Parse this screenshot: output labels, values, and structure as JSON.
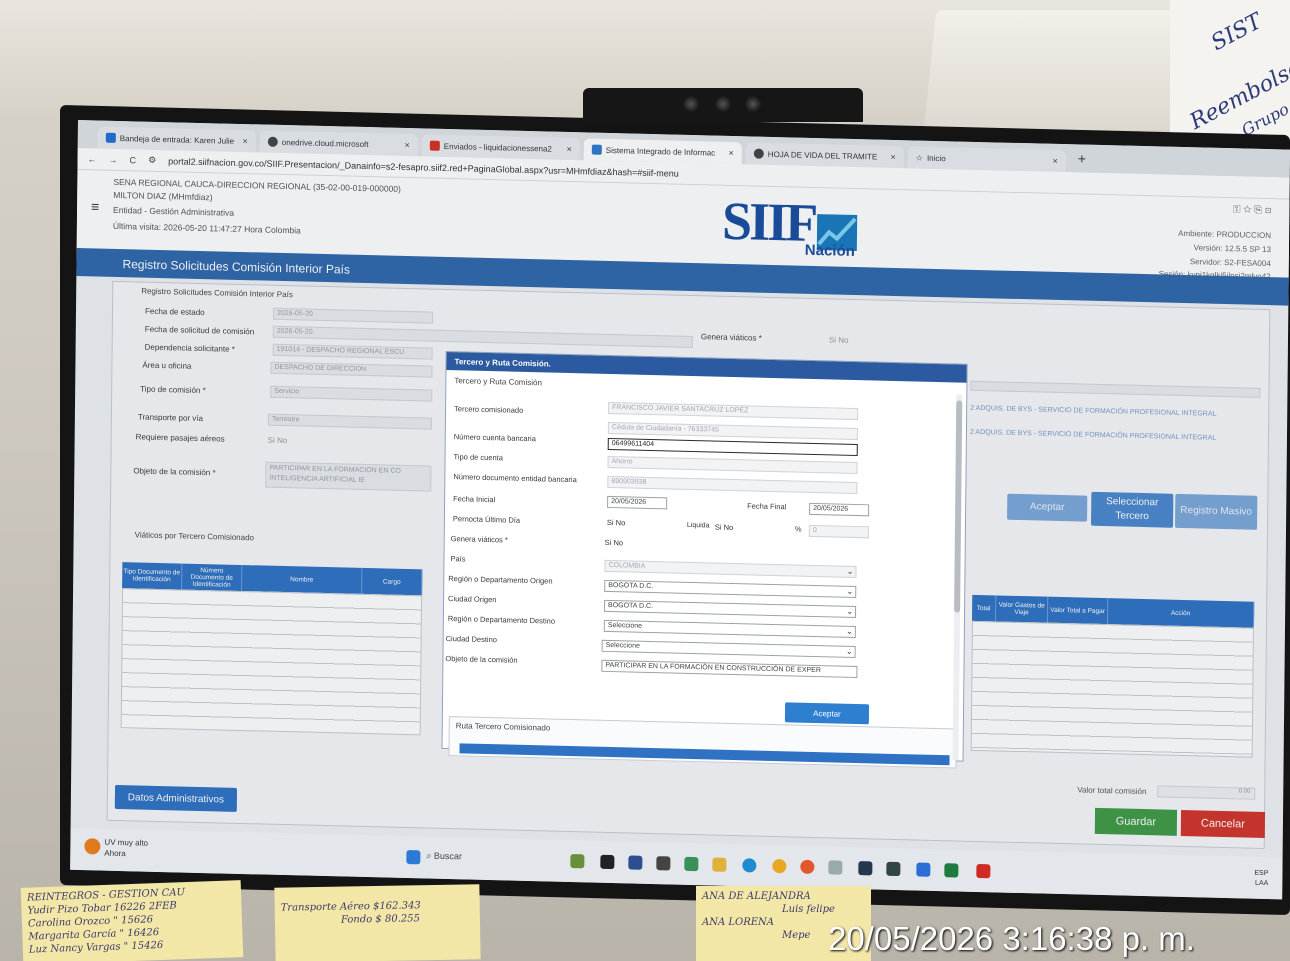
{
  "browser": {
    "tabs": [
      {
        "label": "Bandeja de entrada: Karen Julie",
        "icon_color": "#1f6fd6",
        "icon": "outlook-icon"
      },
      {
        "label": "onedrive.cloud.microsoft",
        "icon_color": "#444444",
        "icon": "globe-icon"
      },
      {
        "label": "Enviados - liquidacionessena2",
        "icon_color": "#d93025",
        "icon": "gmail-icon"
      },
      {
        "label": "Sistema Integrado de Informac",
        "icon_color": "#2e7bcf",
        "icon": "siif-icon"
      },
      {
        "label": "HOJA DE VIDA DEL TRAMITE",
        "icon_color": "#444444",
        "icon": "globe-icon"
      },
      {
        "label": "Inicio",
        "icon_color": "#888888",
        "icon": "star-icon"
      }
    ],
    "url": "portal2.siifnacion.gov.co/SIIF.Presentacion/_Danainfo=s2-fesapro.siif2.red+PaginaGlobal.aspx?usr=MHmfdiaz&hash=#siif-menu"
  },
  "header": {
    "entity_line": "SENA REGIONAL CAUCA-DIRECCION REGIONAL (35-02-00-019-000000)",
    "user_line": "MILTON DIAZ (MHmfdiaz)",
    "profile_line": "Entidad - Gestión Administrativa",
    "last_visit": "Última visita: 2026-05-20 11:47:27 Hora Colombia",
    "logo": "SIIF",
    "logo_sub": "Nación",
    "ambiente": "Ambiente: PRODUCCION",
    "version": "Versión: 12.5.5 SP 13",
    "servidor": "Servidor: S2-FESA004",
    "sesion": "Sesión: kvpj1kglkj5ilnsi2mlvo42"
  },
  "page_title": "Registro Solicitudes Comisión Interior País",
  "form": {
    "section_title": "Registro Solicitudes Comisión Interior País",
    "fecha_estado_label": "Fecha de estado",
    "fecha_estado_value": "2026-05-20",
    "fecha_solicitud_label": "Fecha de solicitud de comisión",
    "fecha_solicitud_value": "2026-05-20",
    "dependencia_label": "Dependencia solicitante *",
    "dependencia_value": "191014 - DESPACHO REGIONAL ESCU",
    "area_label": "Área u oficina",
    "area_value": "DESPACHO DE DIRECCION",
    "tipo_comision_label": "Tipo de comisión *",
    "tipo_comision_value": "Servicio",
    "transporte_label": "Transporte por vía",
    "transporte_value": "Terrestre",
    "pasajes_label": "Requiere pasajes aéreos",
    "pasajes_value": "Si  No",
    "objeto_label": "Objeto de la comisión *",
    "objeto_value": "PARTICIPAR EN LA FORMACION EN CO INTELIGENCIA ARTIFICIAL IE",
    "genera_viaticos_label": "Genera viáticos *",
    "genera_viaticos_value": "Si  No",
    "right_line_1": "2 ADQUIS. DE BYS - SERVICIO DE FORMACIÓN PROFESIONAL INTEGRAL",
    "right_line_2": "2 ADQUIS. DE BYS - SERVICIO DE FORMACIÓN PROFESIONAL INTEGRAL",
    "btn_aceptar": "Aceptar",
    "btn_seleccionar": "Seleccionar Tercero",
    "btn_registro": "Registro Masivo"
  },
  "viaticos": {
    "title": "Viáticos por Tercero Comisionado",
    "columns_left": [
      "Tipo Documento de Identificación",
      "Número Documento de Identificación",
      "Nombre",
      "Cargo"
    ],
    "columns_right": [
      "Total",
      "Valor Gastos de Viaje",
      "Valor Total a Pagar",
      "Acción"
    ]
  },
  "valor_total_label": "Valor total comisión",
  "valor_total_value": "0.00",
  "btn_datos": "Datos Administrativos",
  "btn_guardar": "Guardar",
  "btn_cancelar": "Cancelar",
  "modal": {
    "title": "Tercero y Ruta Comisión.",
    "subtitle": "Tercero y Ruta Comisión",
    "tercero_label": "Tercero comisionado",
    "tercero_value": "FRANCISCO JAVIER SANTACRUZ LOPEZ",
    "cedula_value": "Cédula de Ciudadanía - 76333745",
    "cuenta_label": "Número cuenta bancaria",
    "cuenta_value": "06499611404",
    "tipo_cuenta_label": "Tipo de cuenta",
    "tipo_cuenta_value": "Ahorro",
    "doc_entidad_label": "Número documento entidad bancaria",
    "doc_entidad_value": "890903938",
    "fecha_inicial_label": "Fecha Inicial",
    "fecha_inicial_value": "20/05/2026",
    "fecha_final_label": "Fecha Final",
    "fecha_final_value": "20/05/2026",
    "pernocta_label": "Pernocta Último Día",
    "pernocta_value": "Si  No",
    "liquida_label": "Liquida",
    "liquida_value": "Si  No",
    "percent_label": "%",
    "percent_value": "0",
    "genera_label": "Genera viáticos *",
    "genera_value": "Si  No",
    "pais_label": "País",
    "pais_value": "COLOMBIA",
    "region_origen_label": "Región o Departamento Origen",
    "region_origen_value": "BOGOTA D.C.",
    "ciudad_origen_label": "Ciudad Origen",
    "ciudad_origen_value": "BOGOTA D.C.",
    "region_destino_label": "Región o Departamento Destino",
    "region_destino_value": "Seleccione",
    "ciudad_destino_label": "Ciudad Destino",
    "ciudad_destino_value": "Seleccione",
    "objeto_label": "Objeto de la comisión",
    "objeto_value": "PARTICIPAR EN LA FORMACIÓN EN CONSTRUCCIÓN DE EXPER",
    "btn_aceptar": "Aceptar",
    "ruta_title": "Ruta Tercero Comisionado"
  },
  "taskbar": {
    "weather_line1": "UV muy alto",
    "weather_line2": "Ahora",
    "search": "Buscar",
    "lang_line1": "ESP",
    "lang_line2": "LAA"
  },
  "notes": {
    "note1": [
      "REINTEGROS - GESTION CAU",
      "Yudir Pizo Tobar 16226 2FEB",
      "Carolina Orozco  \" 15626",
      "Margarita García  \" 16426",
      "Luz Nancy Vargas  \" 15426"
    ],
    "note2": [
      "Transporte Aéreo $162.343",
      "Fondo $ 80.255"
    ],
    "note3": [
      "ANA DE ALEJANDRA",
      "Luis felipe",
      "ANA LORENA",
      "Mepe"
    ]
  },
  "whiteboard": [
    "SIST",
    "Reembolsos",
    "Grupo"
  ],
  "photo_timestamp": "20/05/2026 3:16:38 p. m."
}
